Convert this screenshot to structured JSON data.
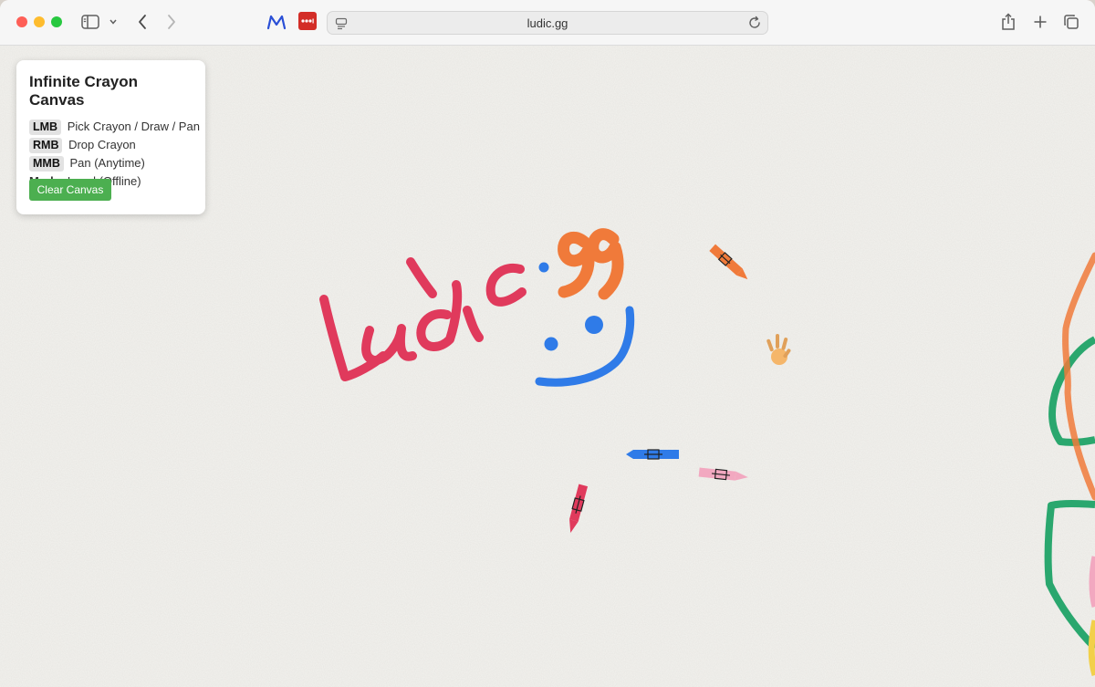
{
  "browser": {
    "url": "ludic.gg"
  },
  "panel": {
    "title": "Infinite Crayon Canvas",
    "controls": [
      {
        "key": "LMB",
        "action": "Pick Crayon / Draw / Pan"
      },
      {
        "key": "RMB",
        "action": "Drop Crayon"
      },
      {
        "key": "MMB",
        "action": "Pan (Anytime)"
      }
    ],
    "mode_label": "Mode:",
    "mode_value": "Local (Offline)",
    "clear_button": "Clear Canvas"
  },
  "colors": {
    "accent_green": "#4caf50",
    "crayon_red": "#e03a5c",
    "crayon_orange": "#f07a3a",
    "crayon_blue": "#2f7be8",
    "crayon_pink": "#f2a8c0",
    "crayon_green": "#2aa76e"
  },
  "icons": [
    "sidebar-icon",
    "chevron-down-icon",
    "back-icon",
    "forward-icon",
    "extension-m-icon",
    "password-manager-icon",
    "page-icon",
    "reload-icon",
    "share-icon",
    "plus-icon",
    "tabs-icon",
    "hand-cursor-icon"
  ]
}
